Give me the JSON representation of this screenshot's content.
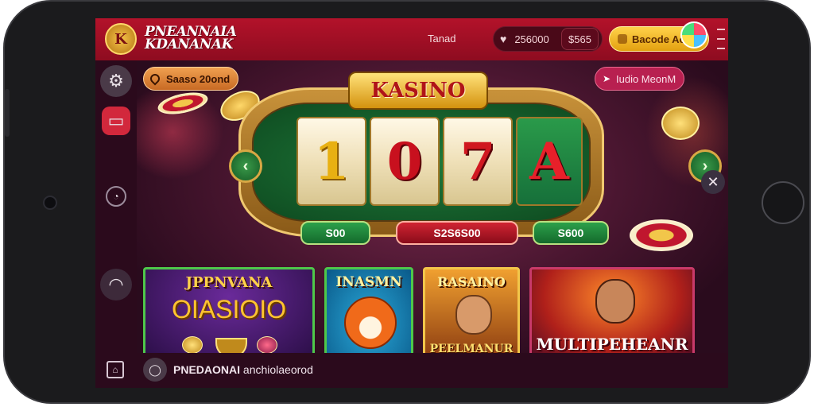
{
  "header": {
    "logo_text": "K",
    "brand_line1": "PNEANNAIA",
    "brand_line2": "KDANANAK",
    "tab_label": "Tanad",
    "balance": "256000",
    "bet": "$565",
    "deposit_label": "Bacode Ao"
  },
  "promo": {
    "left_pill": "Saaso 20ond",
    "right_pill": "Iudio MeonM"
  },
  "slot": {
    "title": "KASINO",
    "reels": [
      "1",
      "0",
      "7",
      "A"
    ],
    "values": [
      "S00",
      "S2S6S00",
      "S600"
    ]
  },
  "cards": [
    {
      "title": "JPPNVANA",
      "big": "OIASIOIO"
    },
    {
      "title": "INASMN"
    },
    {
      "title": "RASAINO",
      "sub": "PEELMANUR"
    },
    {
      "sub": "MULTIPEHEANR"
    }
  ],
  "footer": {
    "ticker_bold": "PNEDAONAI",
    "ticker_rest": " anchiolaeorod"
  }
}
